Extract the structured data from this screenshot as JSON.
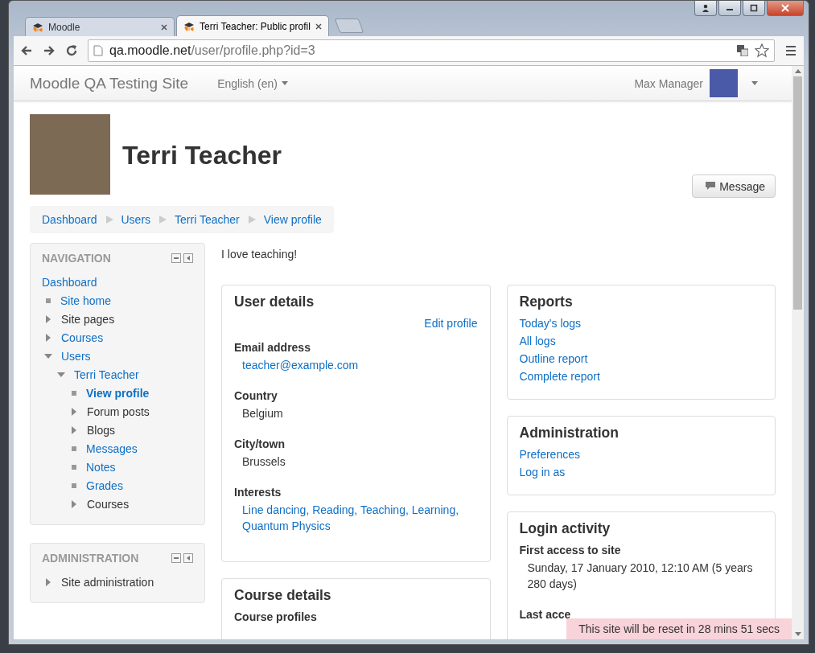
{
  "browser": {
    "tabs": [
      {
        "title": "Moodle",
        "selected": false
      },
      {
        "title": "Terri Teacher: Public profil",
        "selected": true
      }
    ],
    "url_host": "qa.moodle.net",
    "url_path": "/user/profile.php?id=3"
  },
  "navbar": {
    "site_name": "Moodle QA Testing Site",
    "language": "English (en)",
    "user_name": "Max Manager"
  },
  "profile": {
    "name": "Terri Teacher",
    "message_button": "Message"
  },
  "breadcrumb": [
    "Dashboard",
    "Users",
    "Terri Teacher",
    "View profile"
  ],
  "navigation": {
    "title": "NAVIGATION",
    "items": [
      {
        "label": "Dashboard",
        "kind": "root",
        "link": true,
        "selected": false,
        "children": [
          {
            "label": "Site home",
            "kind": "leaf",
            "link": true,
            "selected": false
          },
          {
            "label": "Site pages",
            "kind": "branch",
            "expanded": false,
            "link": false,
            "selected": false
          },
          {
            "label": "Courses",
            "kind": "branch",
            "expanded": false,
            "link": true,
            "selected": false
          },
          {
            "label": "Users",
            "kind": "branch",
            "expanded": true,
            "link": true,
            "selected": false,
            "children": [
              {
                "label": "Terri Teacher",
                "kind": "branch",
                "expanded": true,
                "link": true,
                "selected": false,
                "children": [
                  {
                    "label": "View profile",
                    "kind": "leaf",
                    "link": true,
                    "selected": true
                  },
                  {
                    "label": "Forum posts",
                    "kind": "branch",
                    "expanded": false,
                    "link": false,
                    "selected": false
                  },
                  {
                    "label": "Blogs",
                    "kind": "branch",
                    "expanded": false,
                    "link": false,
                    "selected": false
                  },
                  {
                    "label": "Messages",
                    "kind": "leaf",
                    "link": true,
                    "selected": false
                  },
                  {
                    "label": "Notes",
                    "kind": "leaf",
                    "link": true,
                    "selected": false
                  },
                  {
                    "label": "Grades",
                    "kind": "leaf",
                    "link": true,
                    "selected": false
                  },
                  {
                    "label": "Courses",
                    "kind": "branch",
                    "expanded": false,
                    "link": false,
                    "selected": false
                  }
                ]
              }
            ]
          }
        ]
      }
    ]
  },
  "administration_block": {
    "title": "ADMINISTRATION",
    "items": [
      {
        "label": "Site administration",
        "kind": "branch",
        "expanded": false,
        "link": false,
        "selected": false
      }
    ]
  },
  "description": "I love teaching!",
  "user_details": {
    "title": "User details",
    "edit_link": "Edit profile",
    "fields": [
      {
        "label": "Email address",
        "values": [
          "teacher@example.com"
        ],
        "link": true
      },
      {
        "label": "Country",
        "values": [
          "Belgium"
        ],
        "link": false
      },
      {
        "label": "City/town",
        "values": [
          "Brussels"
        ],
        "link": false
      },
      {
        "label": "Interests",
        "values": [
          "Line dancing,",
          "Reading,",
          "Teaching,",
          "Learning,",
          "Quantum Physics"
        ],
        "link": true
      }
    ]
  },
  "course_details": {
    "title": "Course details",
    "fields": [
      {
        "label": "Course profiles"
      }
    ]
  },
  "reports": {
    "title": "Reports",
    "links": [
      "Today's logs",
      "All logs",
      "Outline report",
      "Complete report"
    ]
  },
  "administration": {
    "title": "Administration",
    "links": [
      "Preferences",
      "Log in as"
    ]
  },
  "login_activity": {
    "title": "Login activity",
    "fields": [
      {
        "label": "First access to site",
        "value": "Sunday, 17 January 2010, 12:10 AM  (5 years 280 days)"
      },
      {
        "label": "Last acce"
      }
    ]
  },
  "reset_notice": "This site will be reset in 28 mins 51 secs"
}
